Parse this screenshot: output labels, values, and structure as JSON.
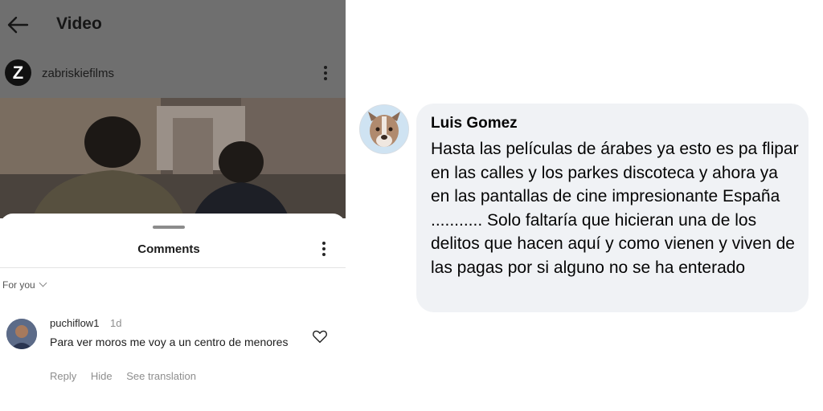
{
  "instagram": {
    "header": {
      "title": "Video"
    },
    "profile": {
      "logo_letter": "Z",
      "username": "zabriskiefilms"
    },
    "comments_sheet": {
      "title": "Comments",
      "filter_label": "For you",
      "comment": {
        "username": "puchiflow1",
        "time": "1d",
        "text": "Para ver moros me voy a un centro de menores",
        "actions": {
          "reply": "Reply",
          "hide": "Hide",
          "see_translation": "See translation"
        }
      }
    }
  },
  "facebook_comment": {
    "name": "Luis Gomez",
    "text": "Hasta las películas de árabes ya esto es pa flipar en las calles y los parkes discoteca y ahora ya en las pantallas de cine impresionante España ........... Solo faltaría que hicieran una de los delitos que hacen aquí y como vienen y viven de las pagas por si alguno no se ha enterado"
  },
  "colors": {
    "overlay_header": "#6f6f6f",
    "bubble_bg": "#f0f2f5",
    "muted_text": "#8e8e8e"
  }
}
